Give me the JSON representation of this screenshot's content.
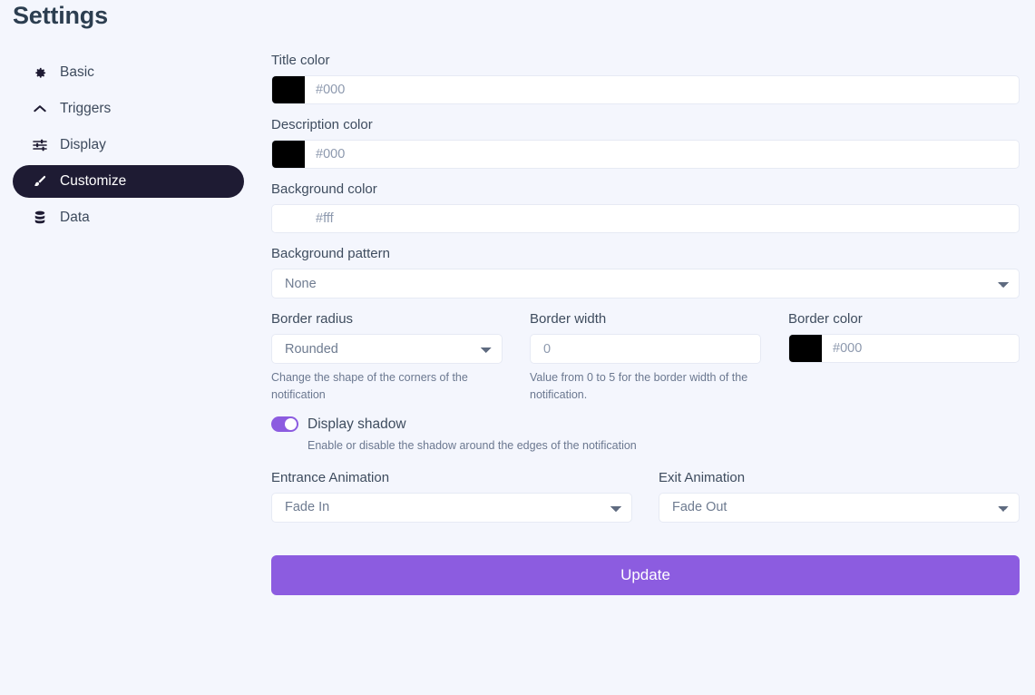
{
  "page": {
    "title": "Settings",
    "accent_color": "#8c5ce0",
    "active_nav_bg": "#1e1b33",
    "background_color": "#f4f6fd"
  },
  "sidebar": {
    "items": [
      {
        "label": "Basic",
        "icon": "gear-icon",
        "active": false
      },
      {
        "label": "Triggers",
        "icon": "chevron-up-icon",
        "active": false
      },
      {
        "label": "Display",
        "icon": "sliders-icon",
        "active": false
      },
      {
        "label": "Customize",
        "icon": "paintbrush-icon",
        "active": true
      },
      {
        "label": "Data",
        "icon": "database-icon",
        "active": false
      }
    ]
  },
  "form": {
    "title_color": {
      "label": "Title color",
      "swatch": "#000000",
      "value": "",
      "placeholder": "#000"
    },
    "description_color": {
      "label": "Description color",
      "swatch": "#000000",
      "value": "",
      "placeholder": "#000"
    },
    "background_color": {
      "label": "Background color",
      "swatch": "#ffffff",
      "value": "",
      "placeholder": "#fff"
    },
    "background_pattern": {
      "label": "Background pattern",
      "selected": "None",
      "options": [
        "None"
      ]
    },
    "border_radius": {
      "label": "Border radius",
      "selected": "Rounded",
      "options": [
        "Rounded"
      ],
      "help": "Change the shape of the corners of the notification"
    },
    "border_width": {
      "label": "Border width",
      "value": "",
      "placeholder": "0",
      "help": "Value from 0 to 5 for the border width of the notification."
    },
    "border_color": {
      "label": "Border color",
      "swatch": "#000000",
      "value": "",
      "placeholder": "#000"
    },
    "display_shadow": {
      "label": "Display shadow",
      "enabled": true,
      "help": "Enable or disable the shadow around the edges of the notification"
    },
    "entrance_animation": {
      "label": "Entrance Animation",
      "selected": "Fade In",
      "options": [
        "Fade In"
      ]
    },
    "exit_animation": {
      "label": "Exit Animation",
      "selected": "Fade Out",
      "options": [
        "Fade Out"
      ]
    },
    "submit": {
      "label": "Update"
    }
  }
}
